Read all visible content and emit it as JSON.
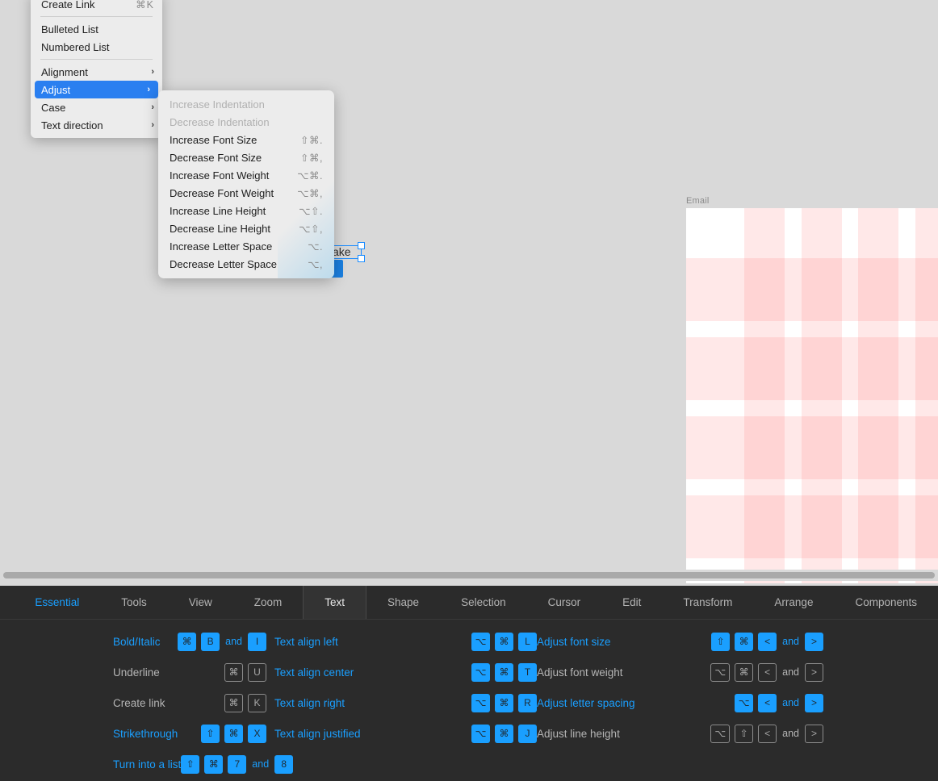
{
  "canvas": {
    "grid_label": "Email",
    "selected_text": "ake",
    "grid_accent": "#ffe0e0",
    "background": "#d9d9d9"
  },
  "context_menu": {
    "items": [
      {
        "label": "Create Link",
        "accel": "⌘K",
        "type": "item"
      },
      {
        "type": "separator"
      },
      {
        "label": "Bulleted List",
        "accel": "",
        "type": "item"
      },
      {
        "label": "Numbered List",
        "accel": "",
        "type": "item"
      },
      {
        "type": "separator"
      },
      {
        "label": "Alignment",
        "accel": "",
        "type": "submenu"
      },
      {
        "label": "Adjust",
        "accel": "",
        "type": "submenu",
        "selected": true
      },
      {
        "label": "Case",
        "accel": "",
        "type": "submenu"
      },
      {
        "label": "Text direction",
        "accel": "",
        "type": "submenu"
      }
    ],
    "chevron": "›",
    "highlight_color": "#2a7ff0"
  },
  "submenu": {
    "items": [
      {
        "label": "Increase Indentation",
        "accel": "",
        "disabled": true
      },
      {
        "label": "Decrease Indentation",
        "accel": "",
        "disabled": true
      },
      {
        "label": "Increase Font Size",
        "accel": "⇧⌘."
      },
      {
        "label": "Decrease Font Size",
        "accel": "⇧⌘,"
      },
      {
        "label": "Increase Font Weight",
        "accel": "⌥⌘."
      },
      {
        "label": "Decrease Font Weight",
        "accel": "⌥⌘,"
      },
      {
        "label": "Increase Line Height",
        "accel": "⌥⇧."
      },
      {
        "label": "Decrease Line Height",
        "accel": "⌥⇧,"
      },
      {
        "label": "Increase Letter Space",
        "accel": "⌥."
      },
      {
        "label": "Decrease Letter Space",
        "accel": "⌥,"
      }
    ]
  },
  "bottom_panel": {
    "tabs": [
      {
        "label": "Essential",
        "state": "accent"
      },
      {
        "label": "Tools",
        "state": "normal"
      },
      {
        "label": "View",
        "state": "normal"
      },
      {
        "label": "Zoom",
        "state": "normal"
      },
      {
        "label": "Text",
        "state": "active"
      },
      {
        "label": "Shape",
        "state": "normal"
      },
      {
        "label": "Selection",
        "state": "normal"
      },
      {
        "label": "Cursor",
        "state": "normal"
      },
      {
        "label": "Edit",
        "state": "normal"
      },
      {
        "label": "Transform",
        "state": "normal"
      },
      {
        "label": "Arrange",
        "state": "normal"
      },
      {
        "label": "Components",
        "state": "normal"
      }
    ],
    "accent_color": "#1a9fff",
    "columns": [
      {
        "rows": [
          {
            "label": "Bold/Italic",
            "highlight": true,
            "keys": [
              {
                "g": "⌘",
                "on": true
              },
              {
                "g": "B",
                "on": true
              },
              {
                "and": true
              },
              {
                "g": "I",
                "on": true
              }
            ]
          },
          {
            "label": "Underline",
            "highlight": false,
            "keys": [
              {
                "g": "⌘",
                "on": false
              },
              {
                "g": "U",
                "on": false
              }
            ]
          },
          {
            "label": "Create link",
            "highlight": false,
            "keys": [
              {
                "g": "⌘",
                "on": false
              },
              {
                "g": "K",
                "on": false
              }
            ]
          },
          {
            "label": "Strikethrough",
            "highlight": true,
            "keys": [
              {
                "g": "⇧",
                "on": true
              },
              {
                "g": "⌘",
                "on": true
              },
              {
                "g": "X",
                "on": true
              }
            ]
          },
          {
            "label": "Turn into a list",
            "highlight": true,
            "keys": [
              {
                "g": "⇧",
                "on": true
              },
              {
                "g": "⌘",
                "on": true
              },
              {
                "g": "7",
                "on": true
              },
              {
                "and": true
              },
              {
                "g": "8",
                "on": true
              }
            ]
          }
        ]
      },
      {
        "rows": [
          {
            "label": "Text align left",
            "highlight": true,
            "keys": [
              {
                "g": "⌥",
                "on": true
              },
              {
                "g": "⌘",
                "on": true
              },
              {
                "g": "L",
                "on": true
              }
            ]
          },
          {
            "label": "Text align center",
            "highlight": true,
            "keys": [
              {
                "g": "⌥",
                "on": true
              },
              {
                "g": "⌘",
                "on": true
              },
              {
                "g": "T",
                "on": true
              }
            ]
          },
          {
            "label": "Text align right",
            "highlight": true,
            "keys": [
              {
                "g": "⌥",
                "on": true
              },
              {
                "g": "⌘",
                "on": true
              },
              {
                "g": "R",
                "on": true
              }
            ]
          },
          {
            "label": "Text align justified",
            "highlight": true,
            "keys": [
              {
                "g": "⌥",
                "on": true
              },
              {
                "g": "⌘",
                "on": true
              },
              {
                "g": "J",
                "on": true
              }
            ]
          }
        ]
      },
      {
        "rows": [
          {
            "label": "Adjust font size",
            "highlight": true,
            "keys": [
              {
                "g": "⇧",
                "on": true
              },
              {
                "g": "⌘",
                "on": true
              },
              {
                "g": "<",
                "on": true
              },
              {
                "and": true
              },
              {
                "g": ">",
                "on": true
              }
            ]
          },
          {
            "label": "Adjust font weight",
            "highlight": false,
            "keys": [
              {
                "g": "⌥",
                "on": false
              },
              {
                "g": "⌘",
                "on": false
              },
              {
                "g": "<",
                "on": false
              },
              {
                "and": true
              },
              {
                "g": ">",
                "on": false
              }
            ]
          },
          {
            "label": "Adjust letter spacing",
            "highlight": true,
            "keys": [
              {
                "g": "⌥",
                "on": true
              },
              {
                "g": "<",
                "on": true
              },
              {
                "and": true
              },
              {
                "g": ">",
                "on": true
              }
            ]
          },
          {
            "label": "Adjust line height",
            "highlight": false,
            "keys": [
              {
                "g": "⌥",
                "on": false
              },
              {
                "g": "⇧",
                "on": false
              },
              {
                "g": "<",
                "on": false
              },
              {
                "and": true
              },
              {
                "g": ">",
                "on": false
              }
            ]
          }
        ]
      }
    ],
    "and_label": "and"
  }
}
